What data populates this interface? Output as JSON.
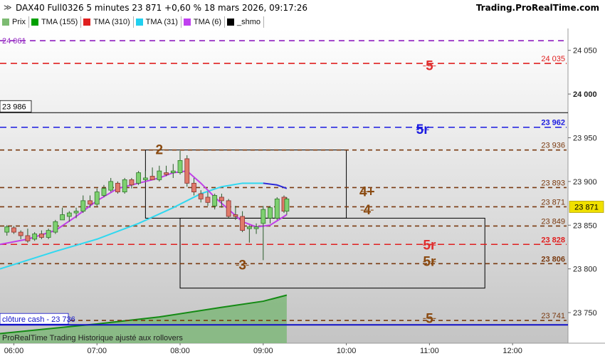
{
  "header": {
    "title": "DAX40 Full0326 5 minutes 23 871 +0,60 % 18 mars 2026, 09:17:26",
    "source": "Trading.ProRealTime.com",
    "collapse_icon": "chevron-double-down-icon"
  },
  "legend": [
    {
      "label": "Prix",
      "color": "#7dbb72"
    },
    {
      "label": "TMA (155)",
      "color": "#00a000"
    },
    {
      "label": "TMA (310)",
      "color": "#e02020"
    },
    {
      "label": "TMA (31)",
      "color": "#20d0f0"
    },
    {
      "label": "TMA (6)",
      "color": "#c040f0"
    },
    {
      "label": "_shmo",
      "color": "#000000"
    }
  ],
  "footer": {
    "credit": "ProRealTime Trading  Historique ajusté aux rollovers",
    "cash_label": "clôture cash -  23 736"
  },
  "current_price_label": "23 871",
  "crosshair_label": "23 986",
  "chart_data": {
    "type": "candlestick",
    "y_range": [
      23715,
      24075
    ],
    "x_range": [
      "05:50",
      "12:40"
    ],
    "y_ticks": [
      {
        "value": 23750,
        "label": "23 750"
      },
      {
        "value": 23800,
        "label": "23 800"
      },
      {
        "value": 23850,
        "label": "23 850"
      },
      {
        "value": 23900,
        "label": "23 900"
      },
      {
        "value": 23950,
        "label": "23 950"
      },
      {
        "value": 24000,
        "label": "24 000"
      },
      {
        "value": 24050,
        "label": "24 050"
      }
    ],
    "x_ticks": [
      "06:00",
      "07:00",
      "08:00",
      "09:00",
      "10:00",
      "11:00",
      "12:00"
    ],
    "levels": [
      {
        "value": 24061,
        "label": "24 061",
        "color": "#9020c0",
        "dash": "8,6",
        "side": "left"
      },
      {
        "value": 24035,
        "label": "24 035",
        "color": "#e02020",
        "dash": "9,6",
        "side": "right"
      },
      {
        "value": 23962,
        "label": "23 962",
        "color": "#1a1ae0",
        "dash": "9,6",
        "side": "right"
      },
      {
        "value": 23936,
        "label": "23 936",
        "color": "#7a3a10",
        "dash": "6,5",
        "side": "right"
      },
      {
        "value": 23893,
        "label": "23 893",
        "color": "#7a3a10",
        "dash": "6,5",
        "side": "right"
      },
      {
        "value": 23871,
        "label": "23 871",
        "color": "#7a3a10",
        "dash": "6,5",
        "side": "right"
      },
      {
        "value": 23849,
        "label": "23 849",
        "color": "#7a3a10",
        "dash": "6,5",
        "side": "right"
      },
      {
        "value": 23828,
        "label": "23 828",
        "color": "#e02020",
        "dash": "9,6",
        "side": "right"
      },
      {
        "value": 23806,
        "label": "23 806",
        "color": "#7a3a10",
        "dash": "6,5",
        "side": "right"
      },
      {
        "value": 23741,
        "label": "23 741",
        "color": "#7a3a10",
        "dash": "6,5",
        "side": "right"
      }
    ],
    "annotations": [
      {
        "text": "5",
        "time": "11:00",
        "value": 24033,
        "color": "#e03030"
      },
      {
        "text": "5r",
        "time": "10:55",
        "value": 23960,
        "color": "#1a1ae0"
      },
      {
        "text": "2",
        "time": "07:45",
        "value": 23937,
        "color": "#8a4a10"
      },
      {
        "text": "4+",
        "time": "10:15",
        "value": 23889,
        "color": "#8a4a10"
      },
      {
        "text": "4",
        "time": "10:15",
        "value": 23868,
        "color": "#8a4a10"
      },
      {
        "text": "5r",
        "time": "11:00",
        "value": 23828,
        "color": "#e03030"
      },
      {
        "text": "5r",
        "time": "11:00",
        "value": 23809,
        "color": "#8a4a10"
      },
      {
        "text": "3",
        "time": "08:45",
        "value": 23805,
        "color": "#8a4a10"
      },
      {
        "text": "5",
        "time": "11:00",
        "value": 23744,
        "color": "#8a4a10"
      }
    ],
    "boxes": [
      {
        "t0": "07:35",
        "t1": "10:00",
        "v_top": 23936,
        "v_bottom": 23858
      },
      {
        "t0": "08:00",
        "t1": "11:40",
        "v_top": 23858,
        "v_bottom": 23778
      }
    ],
    "candles": [
      {
        "t": "05:55",
        "o": 23842,
        "h": 23850,
        "l": 23838,
        "c": 23848
      },
      {
        "t": "06:00",
        "o": 23847,
        "h": 23849,
        "l": 23840,
        "c": 23842
      },
      {
        "t": "06:05",
        "o": 23842,
        "h": 23844,
        "l": 23834,
        "c": 23838
      },
      {
        "t": "06:10",
        "o": 23838,
        "h": 23846,
        "l": 23830,
        "c": 23832
      },
      {
        "t": "06:15",
        "o": 23834,
        "h": 23842,
        "l": 23832,
        "c": 23840
      },
      {
        "t": "06:20",
        "o": 23840,
        "h": 23844,
        "l": 23834,
        "c": 23836
      },
      {
        "t": "06:25",
        "o": 23836,
        "h": 23846,
        "l": 23834,
        "c": 23844
      },
      {
        "t": "06:30",
        "o": 23842,
        "h": 23856,
        "l": 23840,
        "c": 23854
      },
      {
        "t": "06:35",
        "o": 23856,
        "h": 23870,
        "l": 23856,
        "c": 23862
      },
      {
        "t": "06:40",
        "o": 23860,
        "h": 23866,
        "l": 23854,
        "c": 23864
      },
      {
        "t": "06:45",
        "o": 23864,
        "h": 23870,
        "l": 23858,
        "c": 23866
      },
      {
        "t": "06:50",
        "o": 23866,
        "h": 23884,
        "l": 23864,
        "c": 23878
      },
      {
        "t": "06:55",
        "o": 23878,
        "h": 23884,
        "l": 23870,
        "c": 23874
      },
      {
        "t": "07:00",
        "o": 23874,
        "h": 23892,
        "l": 23872,
        "c": 23888
      },
      {
        "t": "07:05",
        "o": 23884,
        "h": 23896,
        "l": 23882,
        "c": 23892
      },
      {
        "t": "07:10",
        "o": 23890,
        "h": 23904,
        "l": 23888,
        "c": 23900
      },
      {
        "t": "07:15",
        "o": 23898,
        "h": 23900,
        "l": 23886,
        "c": 23888
      },
      {
        "t": "07:20",
        "o": 23888,
        "h": 23904,
        "l": 23886,
        "c": 23902
      },
      {
        "t": "07:25",
        "o": 23902,
        "h": 23904,
        "l": 23892,
        "c": 23896
      },
      {
        "t": "07:30",
        "o": 23898,
        "h": 23912,
        "l": 23896,
        "c": 23910
      },
      {
        "t": "07:35",
        "o": 23902,
        "h": 23912,
        "l": 23900,
        "c": 23904
      },
      {
        "t": "07:40",
        "o": 23906,
        "h": 23916,
        "l": 23902,
        "c": 23902
      },
      {
        "t": "07:45",
        "o": 23902,
        "h": 23918,
        "l": 23900,
        "c": 23912
      },
      {
        "t": "07:50",
        "o": 23910,
        "h": 23918,
        "l": 23906,
        "c": 23908
      },
      {
        "t": "07:55",
        "o": 23910,
        "h": 23920,
        "l": 23904,
        "c": 23912
      },
      {
        "t": "08:00",
        "o": 23910,
        "h": 23935,
        "l": 23908,
        "c": 23924
      },
      {
        "t": "08:05",
        "o": 23926,
        "h": 23930,
        "l": 23894,
        "c": 23898
      },
      {
        "t": "08:10",
        "o": 23898,
        "h": 23904,
        "l": 23884,
        "c": 23888
      },
      {
        "t": "08:15",
        "o": 23886,
        "h": 23890,
        "l": 23876,
        "c": 23880
      },
      {
        "t": "08:20",
        "o": 23882,
        "h": 23888,
        "l": 23872,
        "c": 23876
      },
      {
        "t": "08:25",
        "o": 23872,
        "h": 23886,
        "l": 23868,
        "c": 23884
      },
      {
        "t": "08:30",
        "o": 23882,
        "h": 23886,
        "l": 23870,
        "c": 23878
      },
      {
        "t": "08:35",
        "o": 23878,
        "h": 23880,
        "l": 23858,
        "c": 23860
      },
      {
        "t": "08:40",
        "o": 23862,
        "h": 23872,
        "l": 23856,
        "c": 23860
      },
      {
        "t": "08:45",
        "o": 23860,
        "h": 23866,
        "l": 23842,
        "c": 23844
      },
      {
        "t": "08:50",
        "o": 23846,
        "h": 23850,
        "l": 23830,
        "c": 23848
      },
      {
        "t": "08:55",
        "o": 23846,
        "h": 23852,
        "l": 23840,
        "c": 23848
      },
      {
        "t": "09:00",
        "o": 23852,
        "h": 23872,
        "l": 23810,
        "c": 23868
      },
      {
        "t": "09:05",
        "o": 23858,
        "h": 23872,
        "l": 23852,
        "c": 23870
      },
      {
        "t": "09:10",
        "o": 23858,
        "h": 23882,
        "l": 23856,
        "c": 23880
      },
      {
        "t": "09:15",
        "o": 23882,
        "h": 23884,
        "l": 23864,
        "c": 23866
      },
      {
        "t": "09:17",
        "o": 23866,
        "h": 23882,
        "l": 23862,
        "c": 23880
      }
    ],
    "ma_magenta": [
      {
        "t": "05:50",
        "v": 23828
      },
      {
        "t": "06:10",
        "v": 23834
      },
      {
        "t": "06:30",
        "v": 23844
      },
      {
        "t": "06:45",
        "v": 23860
      },
      {
        "t": "07:00",
        "v": 23878
      },
      {
        "t": "07:15",
        "v": 23892
      },
      {
        "t": "07:30",
        "v": 23898
      },
      {
        "t": "07:45",
        "v": 23904
      },
      {
        "t": "07:55",
        "v": 23910
      },
      {
        "t": "08:05",
        "v": 23912
      },
      {
        "t": "08:15",
        "v": 23898
      },
      {
        "t": "08:25",
        "v": 23882
      },
      {
        "t": "08:35",
        "v": 23868
      },
      {
        "t": "08:45",
        "v": 23854
      },
      {
        "t": "08:55",
        "v": 23848
      },
      {
        "t": "09:05",
        "v": 23850
      },
      {
        "t": "09:17",
        "v": 23862
      }
    ],
    "ma_cyan": [
      {
        "t": "05:50",
        "v": 23800
      },
      {
        "t": "06:30",
        "v": 23820
      },
      {
        "t": "07:00",
        "v": 23834
      },
      {
        "t": "07:30",
        "v": 23852
      },
      {
        "t": "07:55",
        "v": 23870
      },
      {
        "t": "08:15",
        "v": 23886
      },
      {
        "t": "08:30",
        "v": 23894
      },
      {
        "t": "08:45",
        "v": 23898
      },
      {
        "t": "09:00",
        "v": 23898
      }
    ],
    "ma_blue": [
      {
        "t": "09:00",
        "v": 23898
      },
      {
        "t": "09:10",
        "v": 23896
      },
      {
        "t": "09:17",
        "v": 23892
      }
    ],
    "ma_green": [
      {
        "t": "05:50",
        "v": 23726
      },
      {
        "t": "07:00",
        "v": 23737
      },
      {
        "t": "07:45",
        "v": 23745
      },
      {
        "t": "08:30",
        "v": 23756
      },
      {
        "t": "09:00",
        "v": 23763
      },
      {
        "t": "09:17",
        "v": 23770
      }
    ],
    "cash_close": 23736
  }
}
